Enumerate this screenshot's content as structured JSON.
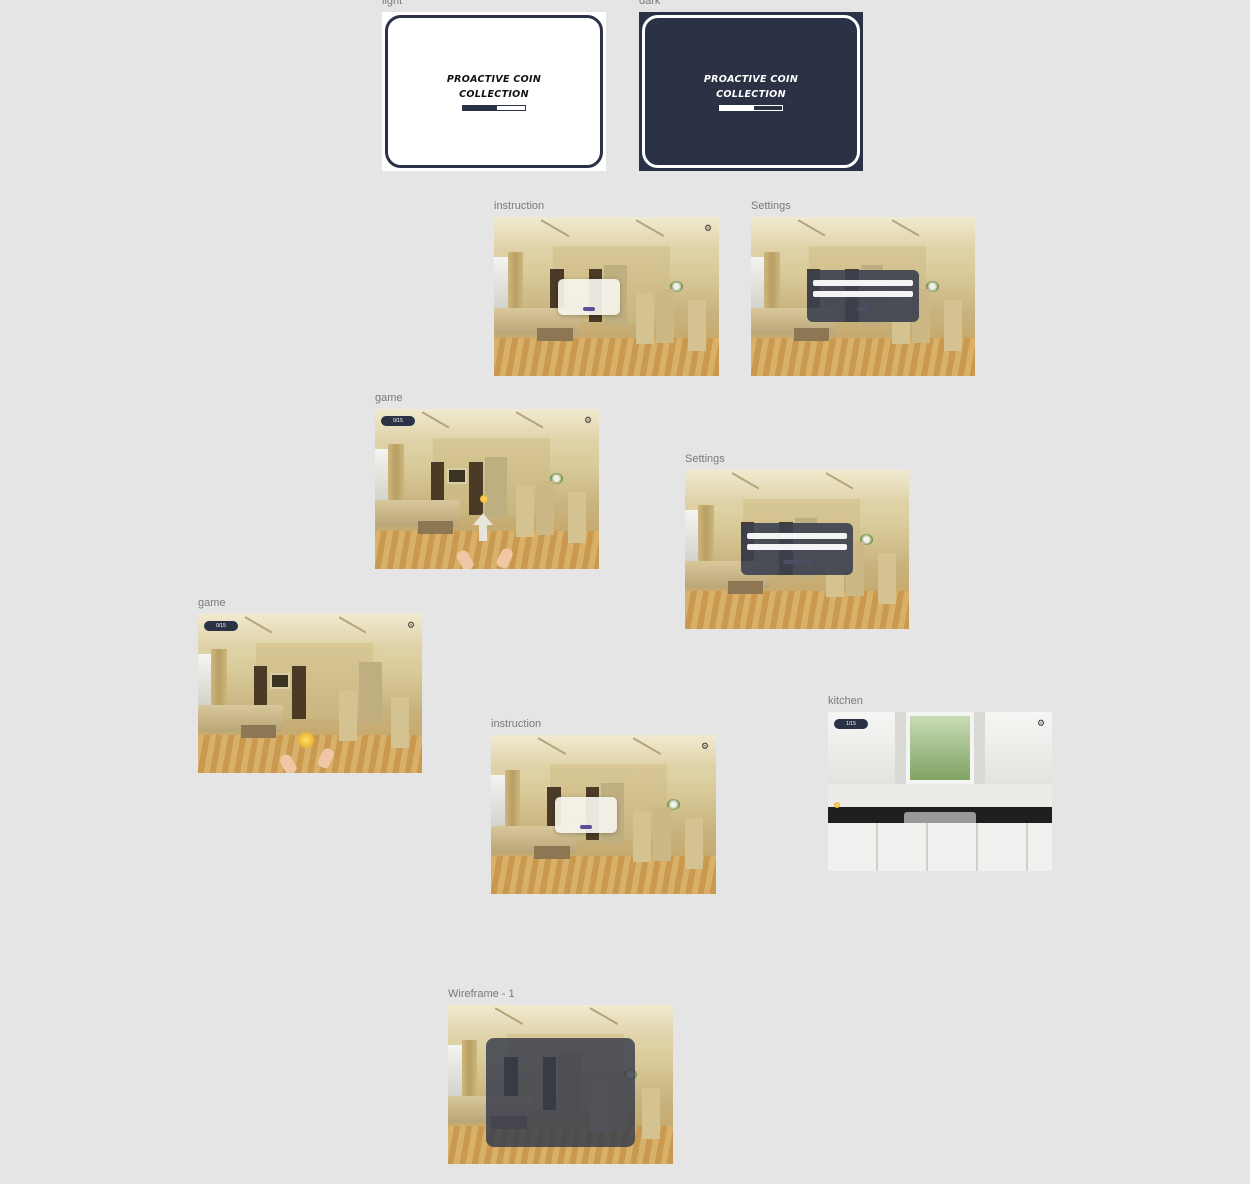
{
  "frames": {
    "light": {
      "label": "light",
      "title_line1": "PROACTIVE COIN",
      "title_line2": "COLLECTION",
      "progress": 0.55
    },
    "dark": {
      "label": "dark",
      "title_line1": "PROACTIVE COIN",
      "title_line2": "COLLECTION",
      "progress": 0.55
    },
    "instruction_1": {
      "label": "instruction"
    },
    "settings_1": {
      "label": "Settings"
    },
    "game_1": {
      "label": "game",
      "counter": "0/15"
    },
    "settings_2": {
      "label": "Settings"
    },
    "game_2": {
      "label": "game",
      "counter": "0/15"
    },
    "instruction_2": {
      "label": "instruction"
    },
    "kitchen": {
      "label": "kitchen",
      "counter": "1/15"
    },
    "wireframe": {
      "label": "Wireframe - 1"
    }
  },
  "colors": {
    "canvas": "#e5e5e5",
    "navy": "#2b3246",
    "accent_button": "#5c4f97",
    "coin": "#e2a21b"
  },
  "icons": {
    "settings": "gear-icon",
    "swipe": "arrow-up-icon",
    "coin": "coin-icon"
  }
}
